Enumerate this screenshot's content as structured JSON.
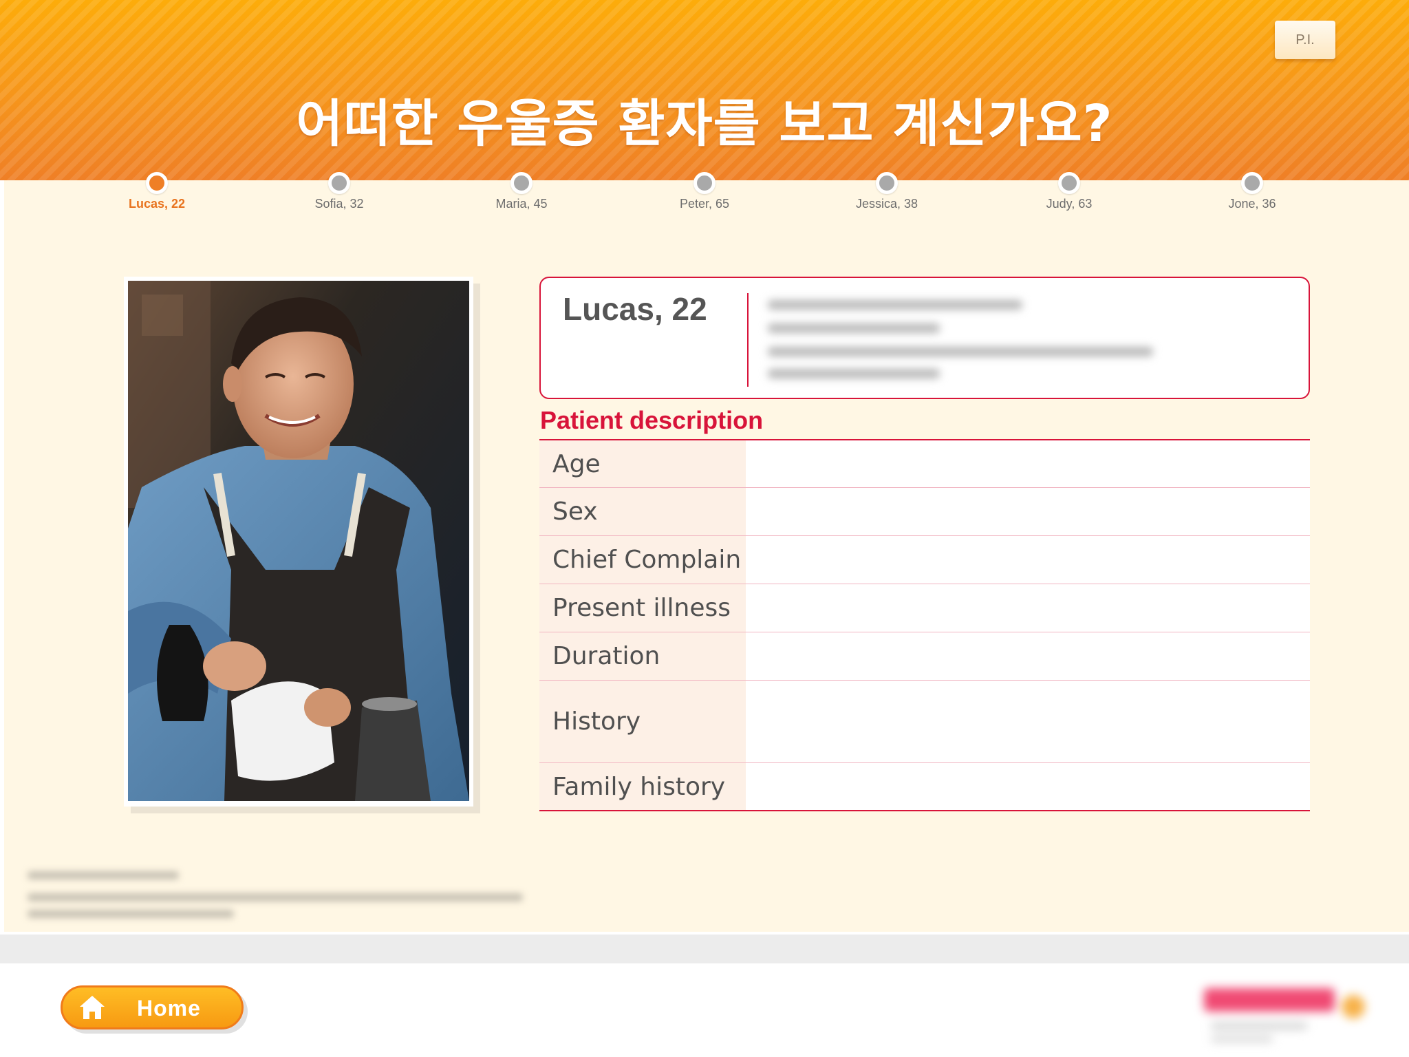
{
  "header": {
    "title": "어떠한 우울증 환자를 보고 계신가요?",
    "pi_label": "P.I."
  },
  "timeline": [
    {
      "label": "Lucas, 22",
      "active": true
    },
    {
      "label": "Sofia, 32",
      "active": false
    },
    {
      "label": "Maria, 45",
      "active": false
    },
    {
      "label": "Peter, 65",
      "active": false
    },
    {
      "label": "Jessica, 38",
      "active": false
    },
    {
      "label": "Judy, 63",
      "active": false
    },
    {
      "label": "Jone, 36",
      "active": false
    }
  ],
  "patient": {
    "name": "Lucas, 22",
    "description_title": "Patient description",
    "rows": [
      {
        "label": "Age",
        "value": ""
      },
      {
        "label": "Sex",
        "value": ""
      },
      {
        "label": "Chief Complain",
        "value": ""
      },
      {
        "label": "Present illness",
        "value": ""
      },
      {
        "label": "Duration",
        "value": ""
      },
      {
        "label": "History",
        "value": ""
      },
      {
        "label": "Family history",
        "value": ""
      }
    ]
  },
  "footer": {
    "home_label": "Home"
  },
  "colors": {
    "accent_orange": "#ef7f26",
    "accent_red": "#d8143a",
    "background_cream": "#fff7e4"
  },
  "icons": {
    "home": "house-icon",
    "pi": "document-button"
  }
}
